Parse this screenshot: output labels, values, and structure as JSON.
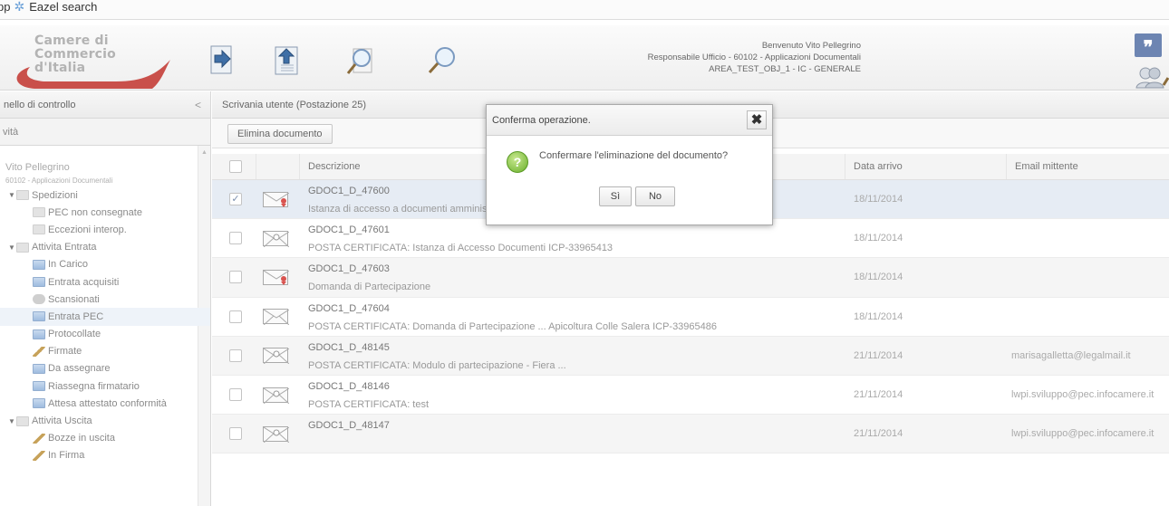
{
  "bookmarks": {
    "app": "pp",
    "eazel": "Eazel search"
  },
  "header": {
    "logo_line1": "Camere di Commercio",
    "logo_line2": "d'Italia",
    "welcome": "Benvenuto Vito Pellegrino",
    "responsabile": "Responsabile Ufficio - 60102 - Applicazioni Documentali",
    "area": "AREA_TEST_OBJ_1 - IC - GENERALE"
  },
  "sidebar": {
    "panel_title": "nello di controllo",
    "section": "vità",
    "user": "Vito Pellegrino",
    "user_office": "60102 - Applicazioni Documentali",
    "items": [
      {
        "label": "Spedizioni",
        "level": 1
      },
      {
        "label": "PEC non consegnate",
        "level": 2
      },
      {
        "label": "Eccezioni interop.",
        "level": 2
      },
      {
        "label": "Attivita Entrata",
        "level": 1
      },
      {
        "label": "In Carico",
        "level": 2
      },
      {
        "label": "Entrata acquisiti",
        "level": 2
      },
      {
        "label": "Scansionati",
        "level": 2
      },
      {
        "label": "Entrata PEC",
        "level": 2
      },
      {
        "label": "Protocollate",
        "level": 2
      },
      {
        "label": "Firmate",
        "level": 2
      },
      {
        "label": "Da assegnare",
        "level": 2
      },
      {
        "label": "Riassegna firmatario",
        "level": 2
      },
      {
        "label": "Attesa attestato conformità",
        "level": 2
      },
      {
        "label": "Attivita Uscita",
        "level": 1
      },
      {
        "label": "Bozze in uscita",
        "level": 2
      },
      {
        "label": "In Firma",
        "level": 2
      }
    ]
  },
  "main": {
    "title": "Scrivania utente (Postazione 25)",
    "delete_button": "Elimina documento",
    "columns": {
      "descrizione": "Descrizione",
      "data_arrivo": "Data arrivo",
      "email_mittente": "Email mittente"
    },
    "rows": [
      {
        "id": "GDOC1_D_47600",
        "desc": "Istanza di accesso a documenti amminis",
        "date": "18/11/2014",
        "email": "",
        "checked": true
      },
      {
        "id": "GDOC1_D_47601",
        "desc": "POSTA CERTIFICATA: Istanza di Accesso Documenti ICP-33965413",
        "date": "18/11/2014",
        "email": "",
        "checked": false
      },
      {
        "id": "GDOC1_D_47603",
        "desc": "Domanda di Partecipazione",
        "date": "18/11/2014",
        "email": "",
        "checked": false
      },
      {
        "id": "GDOC1_D_47604",
        "desc": "POSTA CERTIFICATA: Domanda di Partecipazione ... Apicoltura Colle Salera ICP-33965486",
        "date": "18/11/2014",
        "email": "",
        "checked": false
      },
      {
        "id": "GDOC1_D_48145",
        "desc": "POSTA CERTIFICATA: Modulo di partecipazione - Fiera ...",
        "date": "21/11/2014",
        "email": "marisagalletta@legalmail.it",
        "checked": false
      },
      {
        "id": "GDOC1_D_48146",
        "desc": "POSTA CERTIFICATA: test",
        "date": "21/11/2014",
        "email": "lwpi.sviluppo@pec.infocamere.it",
        "checked": false
      },
      {
        "id": "GDOC1_D_48147",
        "desc": "",
        "date": "21/11/2014",
        "email": "lwpi.sviluppo@pec.infocamere.it",
        "checked": false
      }
    ]
  },
  "dialog": {
    "title": "Conferma operazione.",
    "message": "Confermare l'eliminazione del documento?",
    "yes": "Sì",
    "no": "No"
  }
}
